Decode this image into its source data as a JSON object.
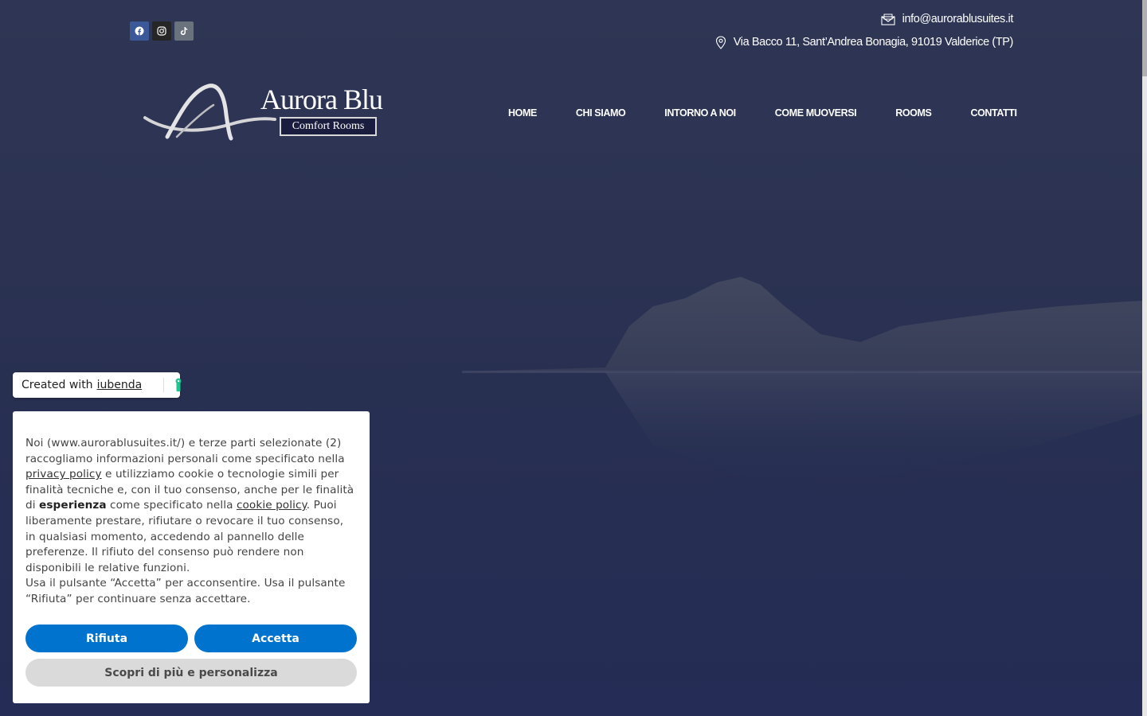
{
  "header": {
    "email": "info@aurorablusuites.it",
    "address": "Via Bacco 11, Sant’Andrea Bonagia, 91019 Valderice (TP)",
    "social": [
      {
        "icon": "facebook-icon",
        "color": "#3b5998"
      },
      {
        "icon": "instagram-icon",
        "color": "#262626"
      },
      {
        "icon": "tiktok-icon",
        "color": "#69727d"
      }
    ]
  },
  "logo": {
    "name": "Aurora Blu",
    "tagline": "Comfort Rooms"
  },
  "nav": {
    "items": [
      "HOME",
      "CHI SIAMO",
      "INTORNO A NOI",
      "COME MUOVERSI",
      "ROOMS",
      "CONTATTI"
    ]
  },
  "iubenda": {
    "prefix": "Created with",
    "link": "iubenda"
  },
  "cookie": {
    "text_1": "Noi (www.aurorablusuites.it/) e terze parti selezionate (2) raccogliamo informazioni personali come specificato nella ",
    "privacy_link": "privacy policy",
    "text_2": " e utilizziamo cookie o tecnologie simili per finalità tecniche e, con il tuo consenso, anche per le finalità di ",
    "bold": "esperienza",
    "text_3": " come specificato nella ",
    "cookie_link": "cookie policy",
    "text_4": ". Puoi liberamente prestare, rifiutare o revocare il tuo consenso, in qualsiasi momento, accedendo al pannello delle preferenze. Il rifiuto del consenso può rendere non disponibili le relative funzioni.",
    "text_5": "Usa il pulsante “Accetta” per acconsentire. Usa il pulsante “Rifiuta” per continuare senza accettare.",
    "reject": "Rifiuta",
    "accept": "Accetta",
    "customize": "Scopri di più e personalizza"
  },
  "colors": {
    "accent": "#0073ce",
    "background": "#2b3250",
    "iubenda_green": "#1cc691"
  }
}
